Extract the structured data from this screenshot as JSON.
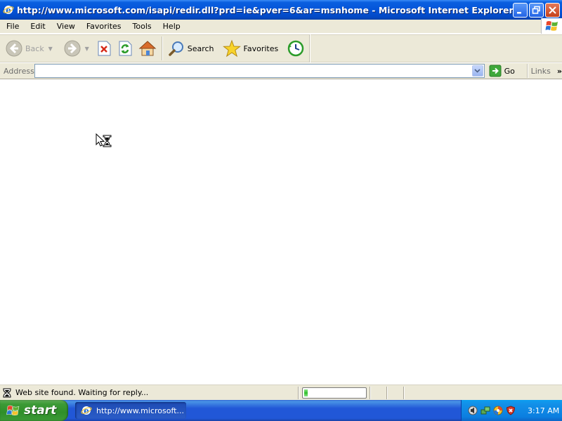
{
  "window": {
    "title": "http://www.microsoft.com/isapi/redir.dll?prd=ie&pver=6&ar=msnhome - Microsoft Internet Explorer",
    "icon": "ie-icon",
    "buttons": [
      "minimize-icon",
      "restore-icon",
      "close-icon"
    ]
  },
  "menu": {
    "items": [
      "File",
      "Edit",
      "View",
      "Favorites",
      "Tools",
      "Help"
    ]
  },
  "toolbar": {
    "back_label": "Back",
    "search_label": "Search",
    "favorites_label": "Favorites",
    "icons": [
      "back-arrow-icon",
      "forward-arrow-icon",
      "stop-icon",
      "refresh-icon",
      "home-icon",
      "search-icon",
      "favorites-star-icon",
      "history-icon"
    ]
  },
  "address": {
    "label": "Address",
    "value": "",
    "go_label": "Go",
    "links_label": "Links",
    "more_label": "»"
  },
  "status": {
    "text": "Web site found. Waiting for reply...",
    "progress": 0.06,
    "icon": "hourglass-icon"
  },
  "taskbar": {
    "start_label": "start",
    "task_label": "http://www.microsoft...",
    "clock": "3:17 AM",
    "tray_icons": [
      "volume-icon",
      "network-icon",
      "security-center-icon",
      "shield-alert-icon"
    ]
  },
  "colors": {
    "titlebar": "#0454d8",
    "chrome": "#ece9d8",
    "taskbar": "#2157d7",
    "start_button": "#3c9a36",
    "tray": "#0b7fe0"
  }
}
